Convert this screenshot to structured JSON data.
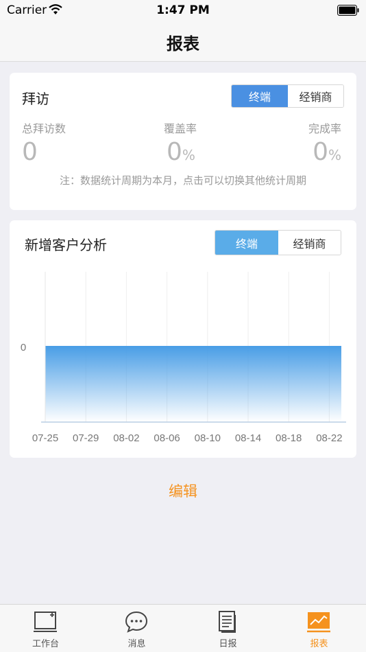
{
  "status_bar": {
    "carrier": "Carrier",
    "time": "1:47 PM"
  },
  "nav": {
    "title": "报表"
  },
  "visit": {
    "title": "拜访",
    "toggle": {
      "left": "终端",
      "right": "经销商",
      "selected": "终端"
    },
    "metrics": [
      {
        "label": "总拜访数",
        "value": "0",
        "unit": ""
      },
      {
        "label": "覆盖率",
        "value": "0",
        "unit": "%"
      },
      {
        "label": "完成率",
        "value": "0",
        "unit": "%"
      }
    ],
    "note": "注：数据统计周期为本月，点击可以切换其他统计周期"
  },
  "analysis": {
    "title": "新增客户分析",
    "toggle": {
      "left": "终端",
      "right": "经销商",
      "selected": "终端"
    }
  },
  "chart_data": {
    "type": "area",
    "title": "",
    "xlabel": "",
    "ylabel": "",
    "x": [
      "07-25",
      "07-29",
      "08-02",
      "08-06",
      "08-10",
      "08-14",
      "08-18",
      "08-22"
    ],
    "series": [
      {
        "values": [
          0,
          0,
          0,
          0,
          0,
          0,
          0,
          0
        ]
      }
    ],
    "yticks": [
      "0"
    ],
    "grid": true,
    "color": "#4a9ee6"
  },
  "edit_label": "编辑",
  "tabs": [
    {
      "label": "工作台",
      "icon": "workbench-icon",
      "active": false
    },
    {
      "label": "消息",
      "icon": "message-icon",
      "active": false
    },
    {
      "label": "日报",
      "icon": "daily-report-icon",
      "active": false
    },
    {
      "label": "报表",
      "icon": "report-chart-icon",
      "active": true
    }
  ],
  "colors": {
    "accent": "#4a90e2",
    "orange": "#f5921e"
  }
}
